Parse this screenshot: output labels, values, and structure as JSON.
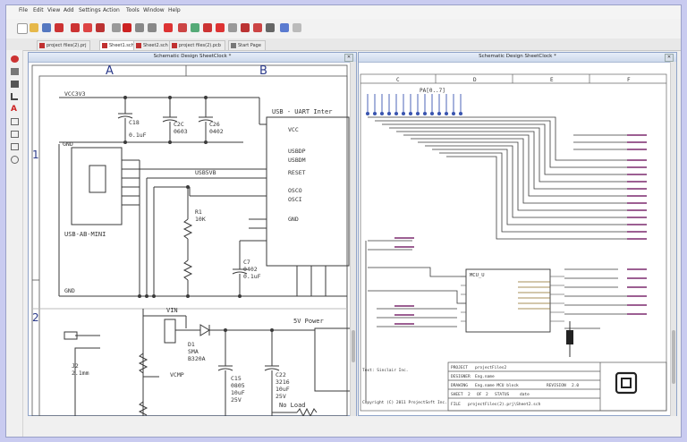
{
  "menu": [
    "File",
    "Edit",
    "View",
    "Add",
    "Settings",
    "Action",
    "Tools",
    "Window",
    "Help"
  ],
  "tabs": [
    "project files(2).prj",
    "Sheet1.sch",
    "Sheet2.sch",
    "project files(2).pcb",
    "Start Page"
  ],
  "left_window": {
    "title": "Schematic Design SheetClock *",
    "columns": [
      "A",
      "B"
    ],
    "rows": [
      "1",
      "2"
    ],
    "labels": {
      "vcc": "VCC3V3",
      "uart_title": "USB - UART Inter",
      "usb_mini": "USB-AB-MINI",
      "gnd1": "GND",
      "gnd2": "GND",
      "usbdp": "USBDP",
      "usbdm": "USBDM",
      "reset": "RESET",
      "osco": "OSCO",
      "osci": "OSCI",
      "gnd_u": "GND",
      "vcc_u": "VCC",
      "usb5v": "USB5VB",
      "c1": "C18",
      "c1v": "0.1uF",
      "c2": "C2C",
      "c2v": "0603",
      "c3": "C26",
      "c3v": "0402",
      "c4": "C7",
      "c4v": "0402",
      "c4u": "0.1uF",
      "vin": "VIN",
      "power_title": "5V Power",
      "d1": "D1",
      "d1a": "SMA",
      "d1b": "B320A",
      "vcmp": "VCMP",
      "c15": "C15",
      "c15v": "0805",
      "c15u": "10uF",
      "c15s": "25V",
      "c22": "C22",
      "c22v": "3216",
      "c22u": "10uF",
      "c22s": "25V",
      "noload": "No Load",
      "j1": "J2",
      "j1v": "2.1mm",
      "r1": "R1",
      "r1v": "10K"
    }
  },
  "right_window": {
    "title": "Schematic Design SheetClock *",
    "columns": [
      "C",
      "D",
      "E",
      "F"
    ],
    "mcu_label": "MCU_U",
    "header_label": "PA[0..7]",
    "title_block": {
      "project_key": "PROJECT",
      "project": "projectFiles2",
      "designer_key": "DESIGNER",
      "designer": "Eng.name",
      "drawing_key": "DRAWING",
      "drawing": "Eng.name MCU block",
      "revision_key": "REVISION",
      "revision": "2.0",
      "sheet_key": "SHEET",
      "sheet": "2",
      "of": "OF",
      "of_val": "2",
      "status": "STATUS",
      "date": "date",
      "file_key": "FILE",
      "file": "projectFiles(2).prj\\Sheet2.sch",
      "company": "Copyright (C) 2011 ProjectSoft Inc."
    },
    "schematic_note": "Text: Sinclair Inc."
  },
  "colors": {
    "accent": "#3d55a8",
    "wire": "#3a3a3a",
    "net": "#7b2a6e",
    "pin": "#3a55b0"
  }
}
